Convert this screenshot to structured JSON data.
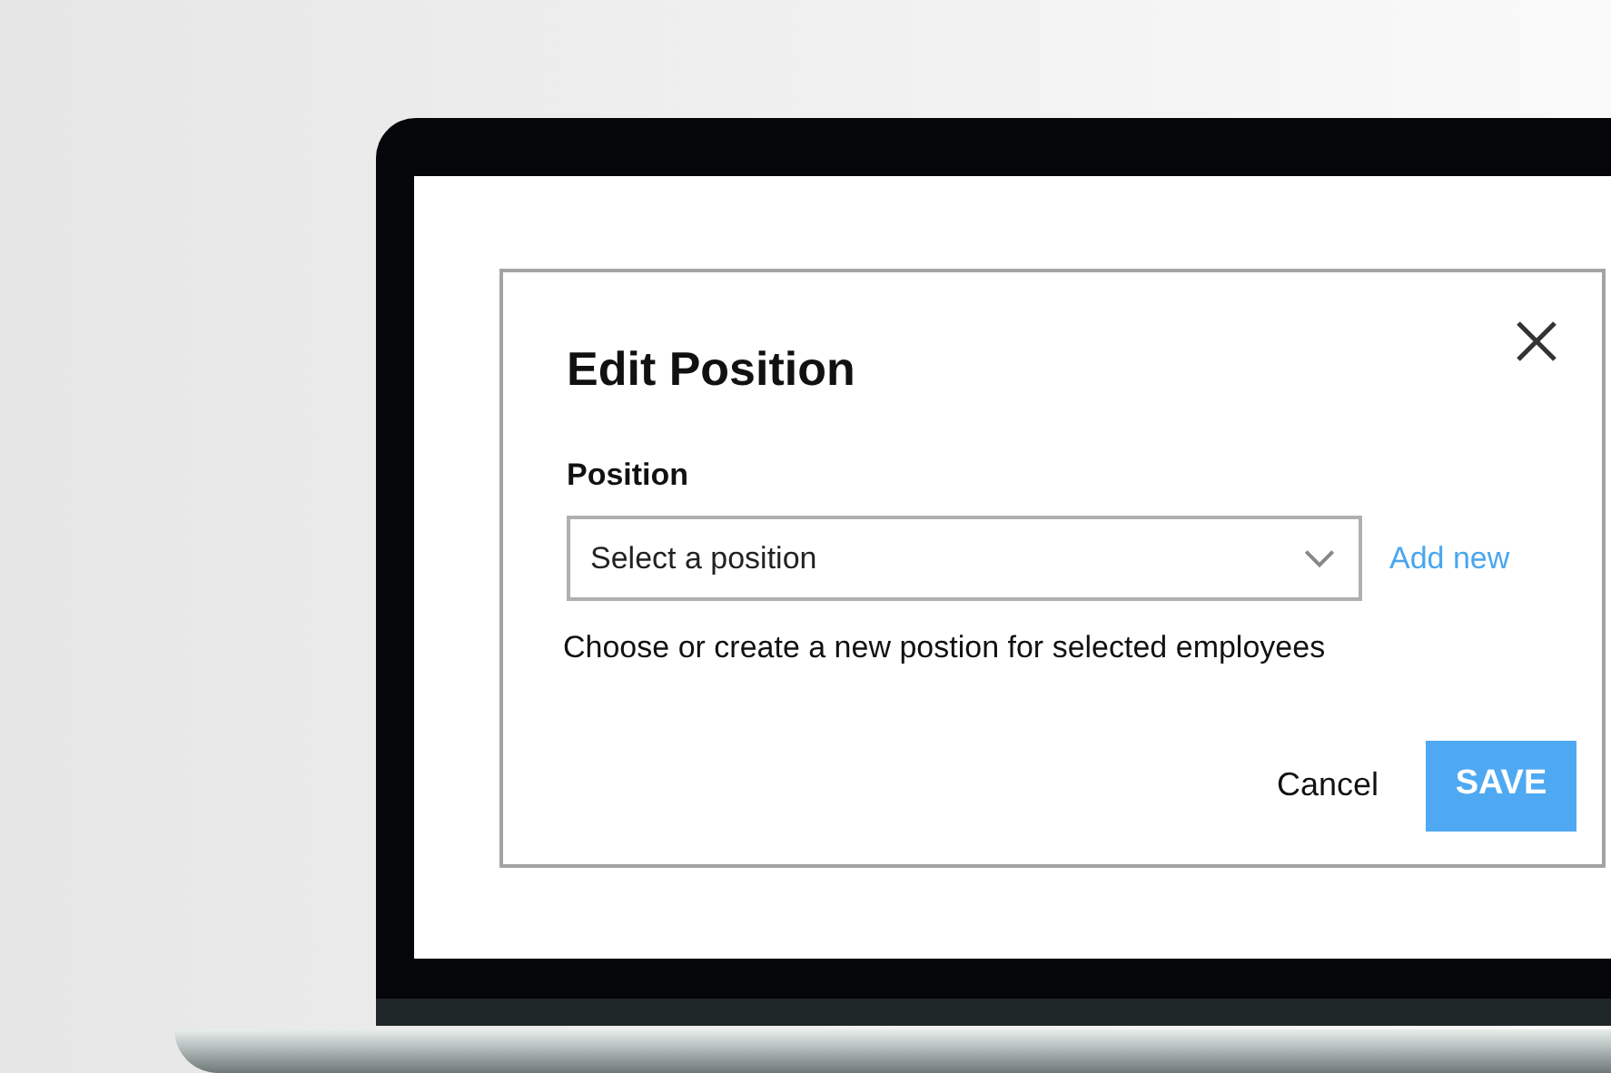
{
  "dialog": {
    "title": "Edit Position",
    "field": {
      "label": "Position",
      "placeholder": "Select a position"
    },
    "add_link": "Add new",
    "help_text": "Choose or create a new postion for selected employees",
    "buttons": [
      {
        "label": "Cancel",
        "kind": "text"
      },
      {
        "label": "SAVE",
        "kind": "primary"
      }
    ]
  }
}
